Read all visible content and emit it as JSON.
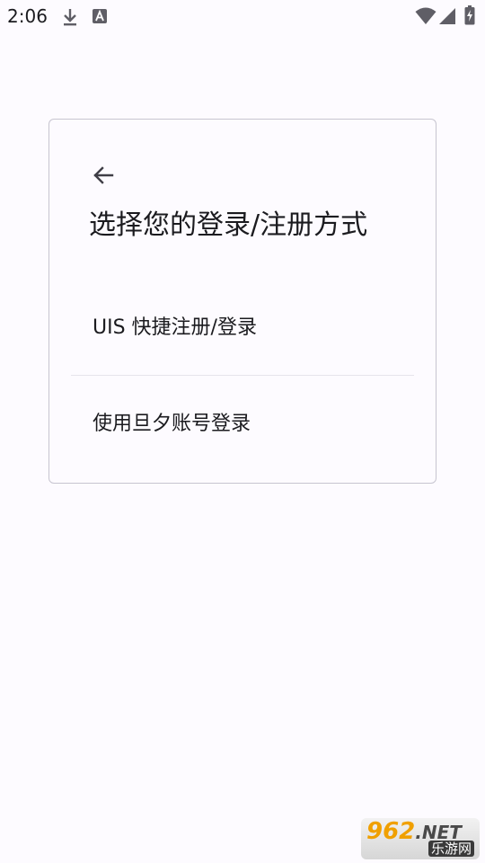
{
  "status_bar": {
    "time": "2:06",
    "icons": [
      "download-icon",
      "text-a-icon",
      "wifi-icon",
      "signal-icon",
      "battery-charging-icon"
    ]
  },
  "card": {
    "back_icon": "arrow-back-icon",
    "title": "选择您的登录/注册方式",
    "options": [
      {
        "label": "UIS 快捷注册/登录"
      },
      {
        "label": "使用旦夕账号登录"
      }
    ]
  },
  "watermark": {
    "brand_number": "962",
    "brand_suffix": ".NET",
    "site_name": "乐游网"
  },
  "colors": {
    "background": "#fdfbff",
    "text": "#1b1b1f",
    "card_border": "#c7c5d0",
    "divider": "#e6e4ec"
  }
}
